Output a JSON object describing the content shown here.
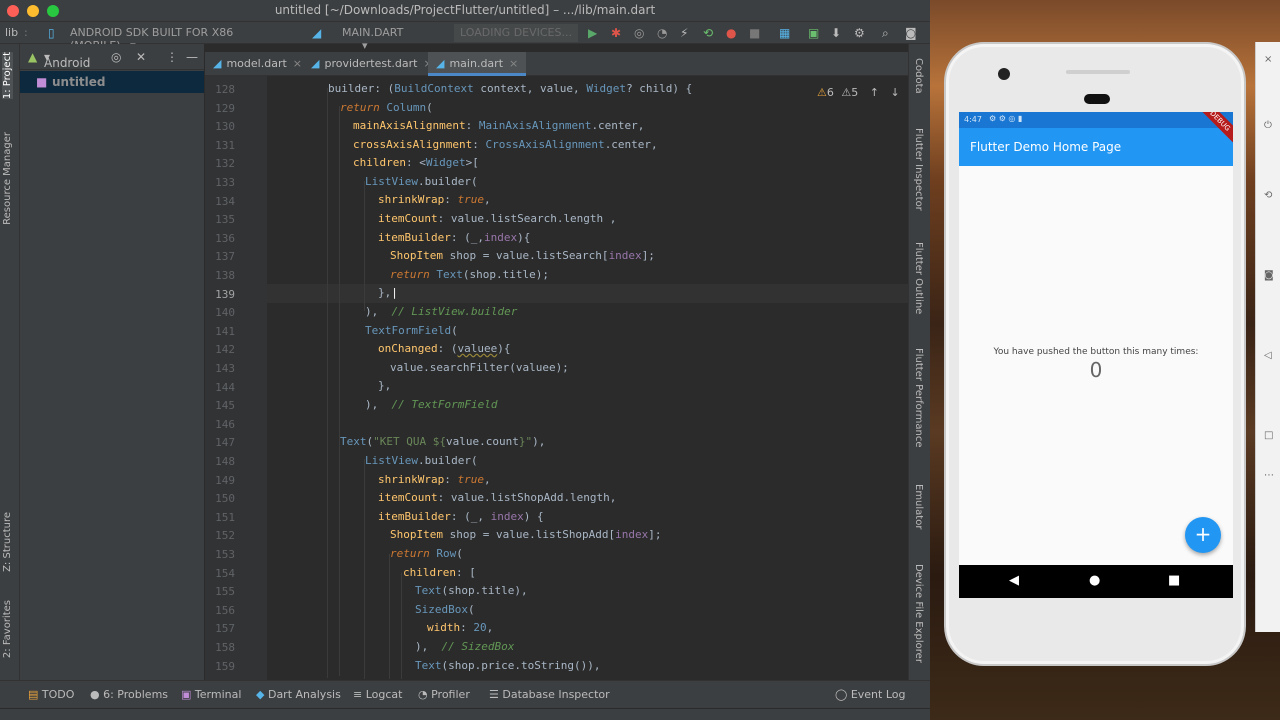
{
  "window": {
    "title": "untitled [~/Downloads/ProjectFlutter/untitled] – .../lib/main.dart",
    "colors": {
      "close": "#fe5f57",
      "minimize": "#febc2e",
      "zoom": "#28c840"
    }
  },
  "toolbar": {
    "breadcrumb": "lib",
    "device_config": "ANDROID SDK BUILT FOR X86 (MOBILE)",
    "run_config": "MAIN.DART",
    "devices": "LOADING DEVICES..."
  },
  "left_tool_tabs": [
    "1: Project",
    "Resource Manager",
    "Z: Structure",
    "2: Favorites"
  ],
  "project_panel": {
    "view": "Android",
    "root": "untitled"
  },
  "editor_tabs": [
    {
      "label": "model.dart",
      "active": false
    },
    {
      "label": "providertest.dart",
      "active": false
    },
    {
      "label": "main.dart",
      "active": true
    }
  ],
  "inspection": {
    "warnings": "6",
    "weak_warnings": "5"
  },
  "current_line": 139,
  "right_tool_tabs": [
    "Codota",
    "Flutter Inspector",
    "Flutter Outline",
    "Flutter Performance",
    "Emulator",
    "Device File Explorer"
  ],
  "bottom_tools": {
    "todo": "TODO",
    "problems": "6: Problems",
    "terminal": "Terminal",
    "dart_analysis": "Dart Analysis",
    "logcat": "Logcat",
    "profiler": "Profiler",
    "database": "Database Inspector",
    "event_log": "Event Log"
  },
  "emulator": {
    "time": "4:47",
    "app_title": "Flutter Demo Home Page",
    "debug_banner": "DEBUG",
    "counter_label": "You have pushed the button this many times:",
    "counter_value": "0",
    "fab_label": "+",
    "colors": {
      "primary": "#2196f3",
      "status": "#1976d2"
    }
  }
}
